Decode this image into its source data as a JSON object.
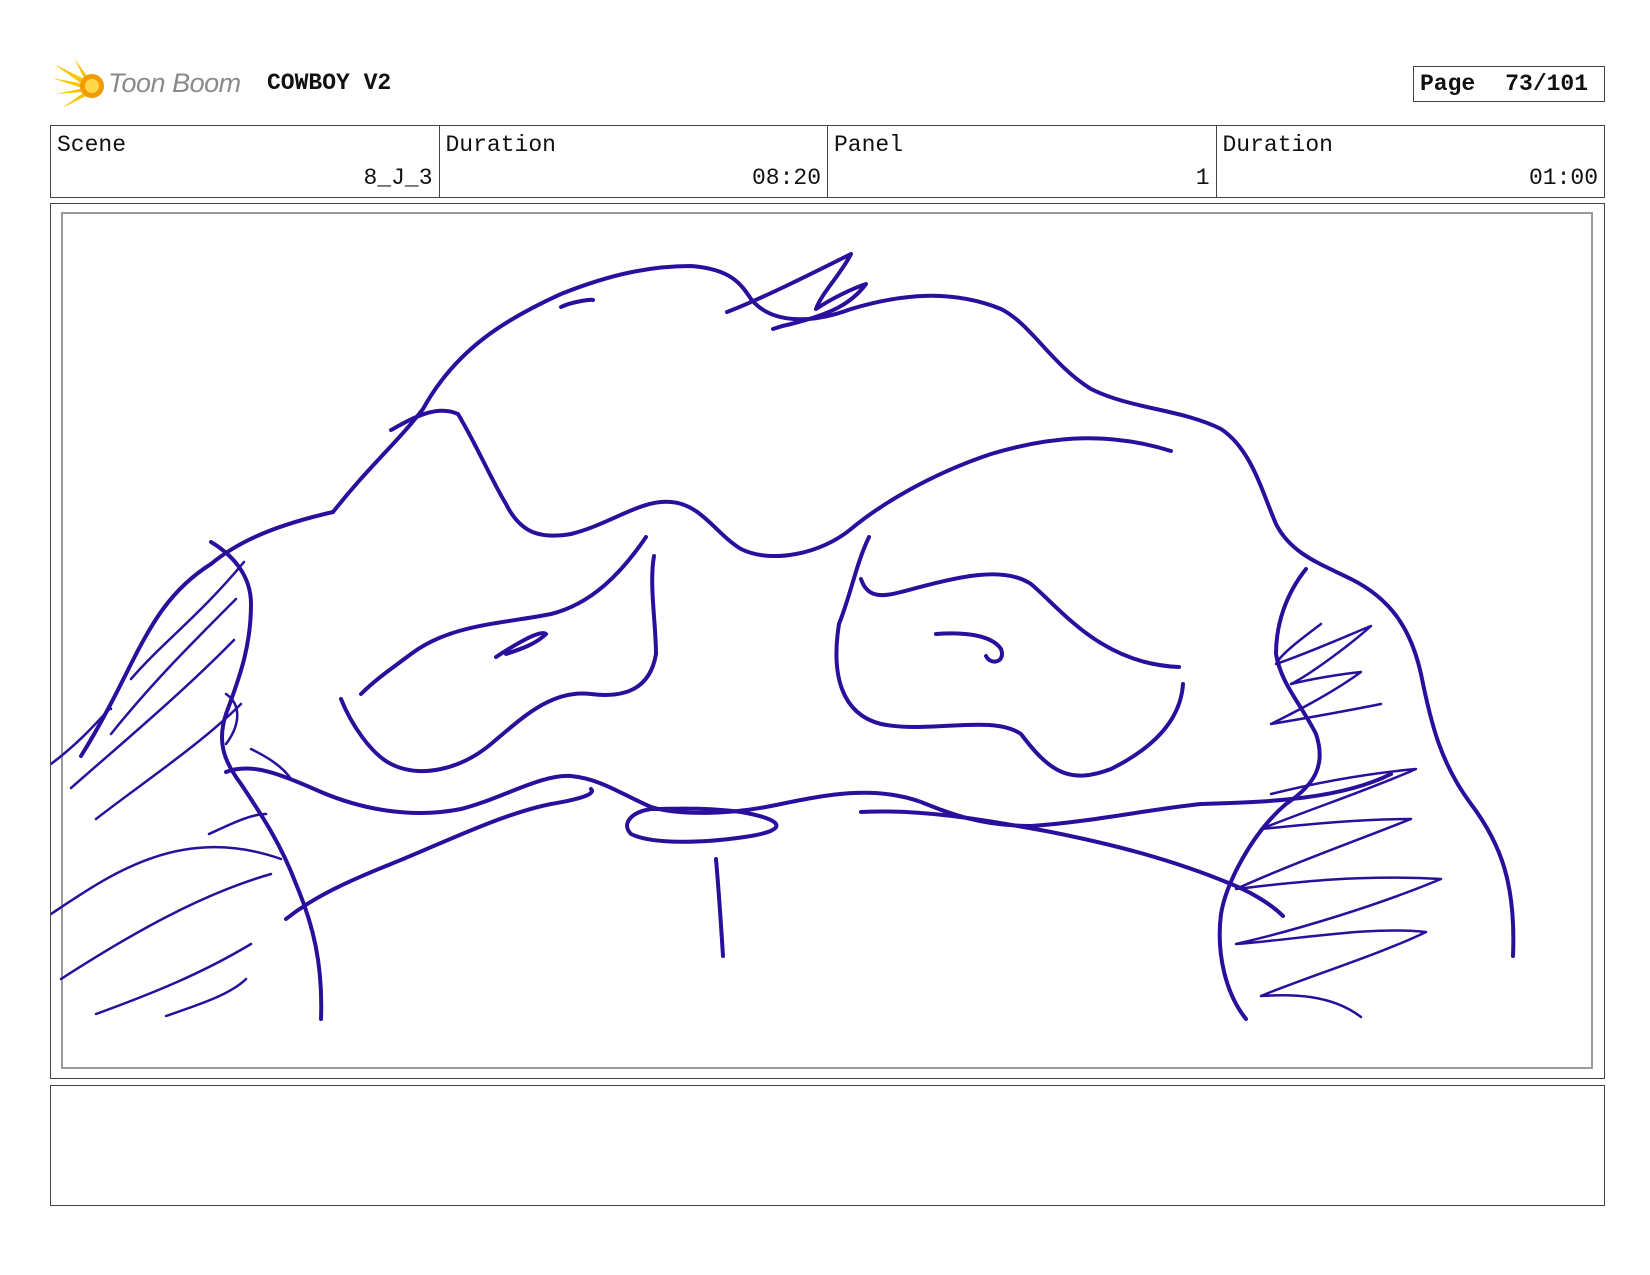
{
  "header": {
    "logo_text": "Toon Boom",
    "project_title": "COWBOY V2",
    "page_label": "Page",
    "page_number": "73/101"
  },
  "info": {
    "scene_label": "Scene",
    "scene_value": "8_J_3",
    "scene_duration_label": "Duration",
    "scene_duration_value": "08:20",
    "panel_label": "Panel",
    "panel_value": "1",
    "panel_duration_label": "Duration",
    "panel_duration_value": "01:00"
  },
  "panel": {
    "sketch_color": "#2a0f9c",
    "frame_color": "#9a9a9a"
  },
  "notes": {
    "text": ""
  },
  "colors": {
    "logo_yellow": "#f7c600",
    "logo_orange": "#f39a00",
    "logo_text": "#8a8a8a"
  }
}
